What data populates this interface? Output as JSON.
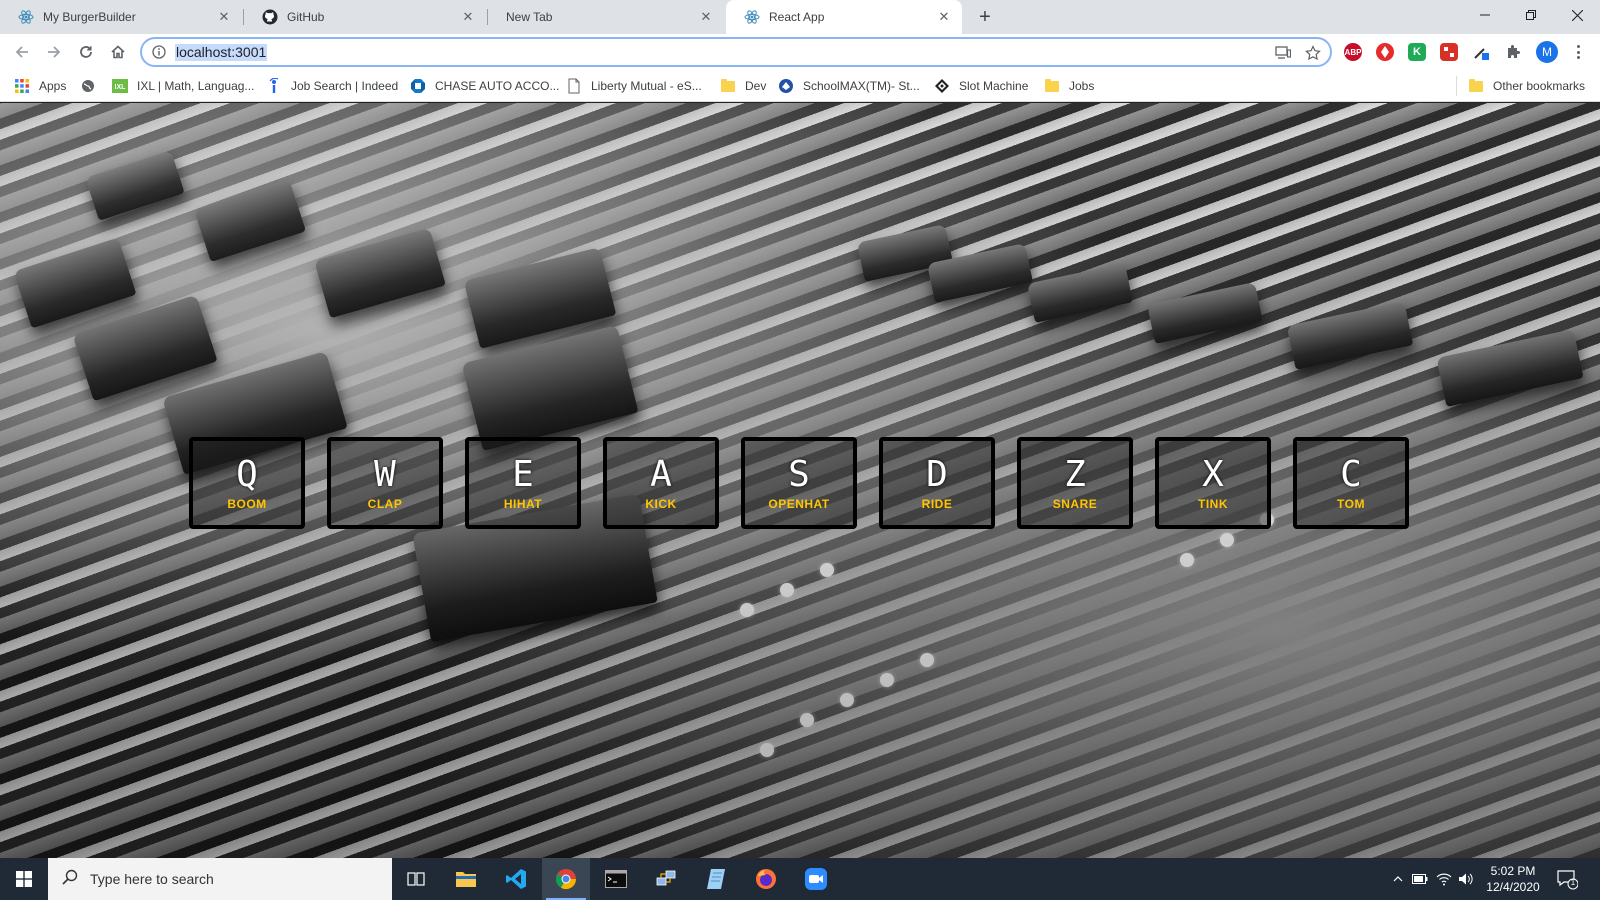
{
  "browser": {
    "tabs": [
      {
        "title": "My BurgerBuilder",
        "icon": "react-icon",
        "active": false
      },
      {
        "title": "GitHub",
        "icon": "github-icon",
        "active": false
      },
      {
        "title": "New Tab",
        "icon": "",
        "active": false
      },
      {
        "title": "React App",
        "icon": "react-icon",
        "active": true
      }
    ],
    "address": "localhost:3001",
    "profile_initial": "M",
    "extensions": [
      {
        "name": "adblock-extension-icon",
        "label": "ABP",
        "color": "#c70d2c"
      },
      {
        "name": "red-extension-icon",
        "label": "",
        "color": "#e52b2b"
      },
      {
        "name": "green-k-extension-icon",
        "label": "K",
        "color": "#1faa55"
      },
      {
        "name": "red-grid-extension-icon",
        "label": "",
        "color": "#d93025"
      }
    ]
  },
  "bookmarks": [
    {
      "label": "Apps",
      "icon": "apps-grid-icon"
    },
    {
      "label": "",
      "icon": "globe-icon"
    },
    {
      "label": "IXL | Math, Languag...",
      "icon": "ixl-icon"
    },
    {
      "label": "Job Search | Indeed",
      "icon": "indeed-icon"
    },
    {
      "label": "CHASE AUTO ACCO...",
      "icon": "chase-icon"
    },
    {
      "label": "Liberty Mutual - eS...",
      "icon": "page-icon"
    },
    {
      "label": "Dev",
      "icon": "folder-icon"
    },
    {
      "label": "SchoolMAX(TM)- St...",
      "icon": "schoolmax-icon"
    },
    {
      "label": "Slot Machine",
      "icon": "slot-machine-icon"
    },
    {
      "label": "Jobs",
      "icon": "folder-icon"
    },
    {
      "label": "Other bookmarks",
      "icon": "folder-icon"
    }
  ],
  "drum_pads": [
    {
      "key": "Q",
      "sound": "BOOM"
    },
    {
      "key": "W",
      "sound": "CLAP"
    },
    {
      "key": "E",
      "sound": "HIHAT"
    },
    {
      "key": "A",
      "sound": "KICK"
    },
    {
      "key": "S",
      "sound": "OPENHAT"
    },
    {
      "key": "D",
      "sound": "RIDE"
    },
    {
      "key": "Z",
      "sound": "SNARE"
    },
    {
      "key": "X",
      "sound": "TINK"
    },
    {
      "key": "C",
      "sound": "TOM"
    }
  ],
  "colors": {
    "pad_label": "#ffc600",
    "pad_key": "#ffffff",
    "taskbar": "#1f2a36"
  },
  "taskbar": {
    "search_placeholder": "Type here to search",
    "apps": [
      "task-view-icon",
      "file-explorer-icon",
      "vscode-icon",
      "chrome-icon",
      "terminal-icon",
      "network-tool-icon",
      "notepad-icon",
      "firefox-icon",
      "zoom-icon"
    ],
    "time": "5:02 PM",
    "date": "12/4/2020",
    "notification_count": "1"
  }
}
